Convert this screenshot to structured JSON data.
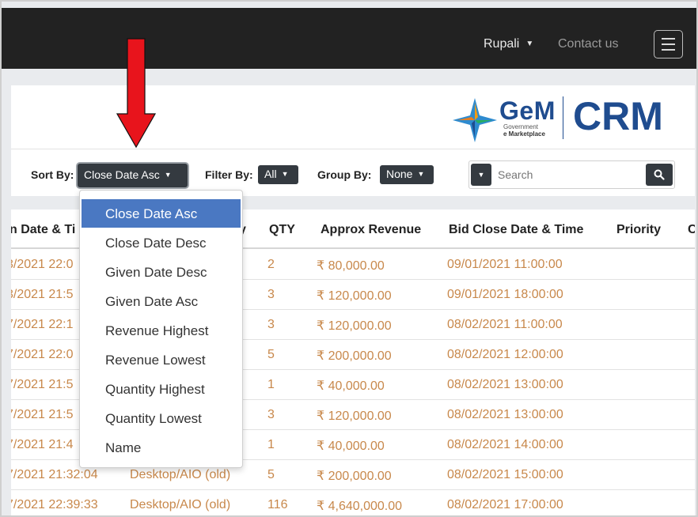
{
  "nav": {
    "user_name": "Rupali",
    "contact_label": "Contact us"
  },
  "logo": {
    "gem": "GeM",
    "government": "Government",
    "marketplace": "e Marketplace",
    "crm": "CRM"
  },
  "toolbar": {
    "sort_label": "Sort By:",
    "sort_value": "Close Date Asc",
    "filter_label": "Filter By:",
    "filter_value": "All",
    "group_label": "Group By:",
    "group_value": "None",
    "search_placeholder": "Search"
  },
  "sort_menu": {
    "options": [
      "Close Date Asc",
      "Close Date Desc",
      "Given Date Desc",
      "Given Date Asc",
      "Revenue Highest",
      "Revenue Lowest",
      "Quantity Highest",
      "Quantity Lowest",
      "Name"
    ],
    "selected": "Close Date Asc"
  },
  "table": {
    "headers": [
      "n Date & Ti",
      "y",
      "QTY",
      "Approx Revenue",
      "Bid Close Date & Time",
      "Priority",
      "C"
    ],
    "rows": [
      [
        "3/2021 22:0",
        "",
        "2",
        "₹ 80,000.00",
        "09/01/2021 11:00:00"
      ],
      [
        "3/2021 21:5",
        "",
        "3",
        "₹ 120,000.00",
        "09/01/2021 18:00:00"
      ],
      [
        "7/2021 22:1",
        "",
        "3",
        "₹ 120,000.00",
        "08/02/2021 11:00:00"
      ],
      [
        "7/2021 22:0",
        "",
        "5",
        "₹ 200,000.00",
        "08/02/2021 12:00:00"
      ],
      [
        "7/2021 21:5",
        "",
        "1",
        "₹ 40,000.00",
        "08/02/2021 13:00:00"
      ],
      [
        "7/2021 21:5",
        "",
        "3",
        "₹ 120,000.00",
        "08/02/2021 13:00:00"
      ],
      [
        "7/2021 21:4",
        "",
        "1",
        "₹ 40,000.00",
        "08/02/2021 14:00:00"
      ],
      [
        "7/2021 21:32:04",
        "Desktop/AIO (old)",
        "5",
        "₹ 200,000.00",
        "08/02/2021 15:00:00"
      ],
      [
        "7/2021 22:39:33",
        "Desktop/AIO (old)",
        "116",
        "₹ 4,640,000.00",
        "08/02/2021 17:00:00"
      ]
    ]
  },
  "colors": {
    "navbar": "#222222",
    "cell_text": "#c8884b",
    "brand_blue": "#1f4c8f",
    "menu_active": "#4a78c2",
    "annotation_arrow": "#e8141c"
  }
}
